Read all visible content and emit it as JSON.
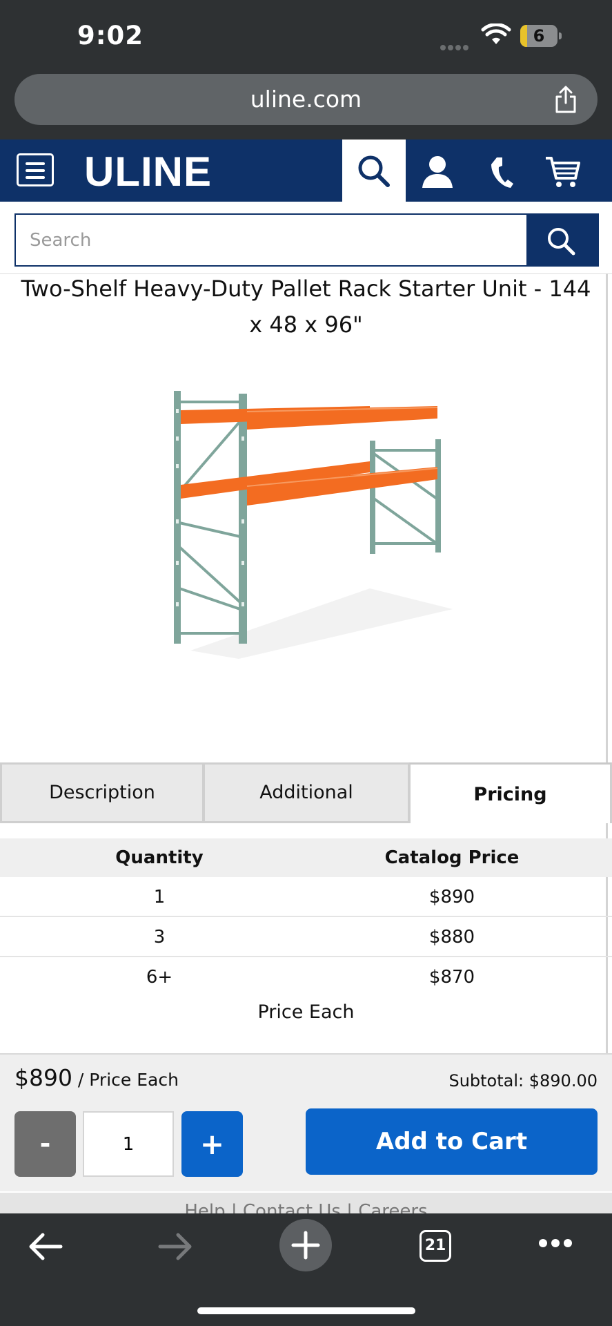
{
  "status_bar": {
    "time": "9:02",
    "battery": "6"
  },
  "browser": {
    "url": "uline.com",
    "tab_count": "21"
  },
  "site": {
    "logo": "ULINE",
    "search_placeholder": "Search"
  },
  "product": {
    "title": "Two-Shelf Heavy-Duty Pallet Rack Starter Unit - 144 x 48 x 96\""
  },
  "tabs": [
    {
      "label": "Description",
      "active": false
    },
    {
      "label": "Additional Information",
      "active": false
    },
    {
      "label": "Pricing",
      "active": true
    }
  ],
  "pricing": {
    "headers": [
      "Quantity",
      "Catalog Price"
    ],
    "rows": [
      {
        "qty": "1",
        "price": "$890"
      },
      {
        "qty": "3",
        "price": "$880"
      },
      {
        "qty": "6+",
        "price": "$870"
      }
    ],
    "note": "Price Each"
  },
  "cart": {
    "unit_price": "$890",
    "unit_suffix": " / Price Each",
    "subtotal": "Subtotal: $890.00",
    "minus": "-",
    "quantity": "1",
    "plus": "+",
    "add_to_cart": "Add to Cart"
  },
  "footer": {
    "links": "Help  |  Contact Us  |  Careers"
  },
  "colors": {
    "brand_navy": "#0e3168",
    "accent_blue": "#0b64c9",
    "rack_orange": "#f36c21",
    "rack_green": "#7fa59b"
  }
}
